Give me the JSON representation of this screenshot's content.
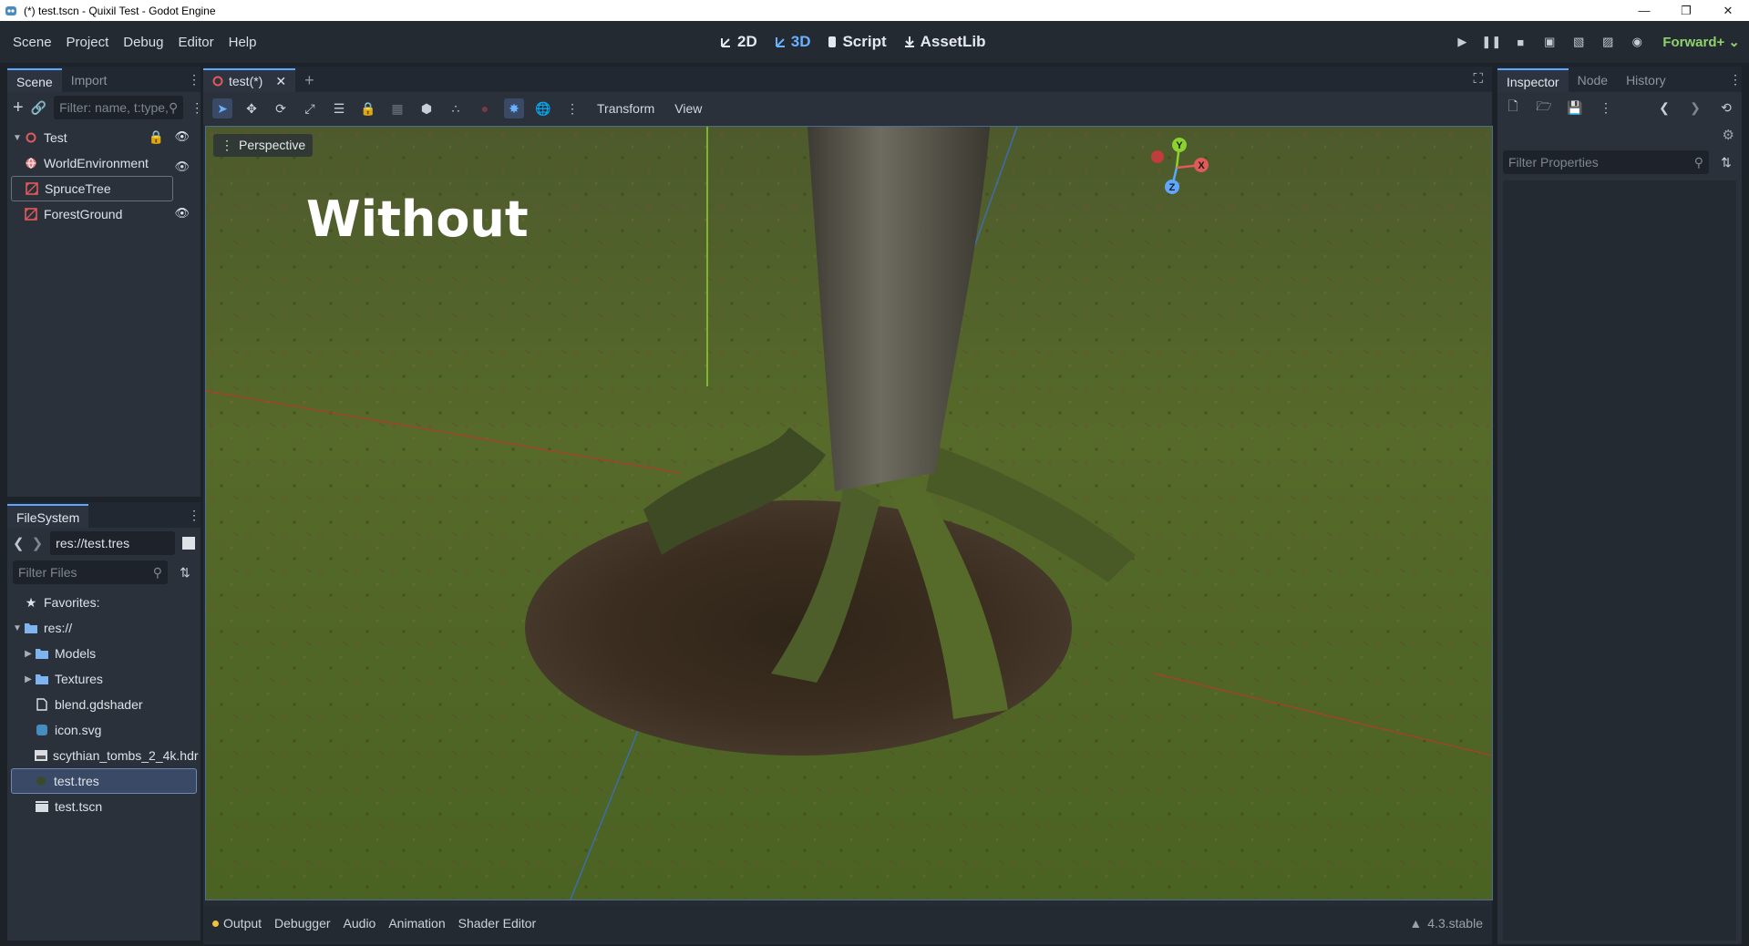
{
  "window": {
    "title": "(*) test.tscn - Quixil Test - Godot Engine",
    "minimize_icon": "minimize-icon",
    "maximize_icon": "restore-icon",
    "close_icon": "close-icon"
  },
  "menu": [
    "Scene",
    "Project",
    "Debug",
    "Editor",
    "Help"
  ],
  "workspaces": [
    {
      "label": "2D",
      "icon": "2d-icon",
      "active": false
    },
    {
      "label": "3D",
      "icon": "3d-icon",
      "active": true
    },
    {
      "label": "Script",
      "icon": "script-icon",
      "active": false
    },
    {
      "label": "AssetLib",
      "icon": "assetlib-icon",
      "active": false
    }
  ],
  "renderer": "Forward+",
  "scene_dock": {
    "tabs": [
      "Scene",
      "Import"
    ],
    "filter_placeholder": "Filter: name, t:type,",
    "nodes": [
      {
        "name": "Test",
        "icon": "node3d-icon"
      },
      {
        "name": "WorldEnvironment",
        "icon": "world-environment-icon"
      },
      {
        "name": "SpruceTree",
        "icon": "mesh-instance-icon"
      },
      {
        "name": "ForestGround",
        "icon": "mesh-instance-icon"
      }
    ]
  },
  "filesystem": {
    "tab": "FileSystem",
    "path": "res://test.tres",
    "filter_placeholder": "Filter Files",
    "items": [
      {
        "label": "Favorites:",
        "icon": "star-icon"
      },
      {
        "label": "res://",
        "icon": "folder-icon"
      },
      {
        "label": "Models",
        "icon": "folder-icon"
      },
      {
        "label": "Textures",
        "icon": "folder-icon"
      },
      {
        "label": "blend.gdshader",
        "icon": "shader-file-icon"
      },
      {
        "label": "icon.svg",
        "icon": "image-icon"
      },
      {
        "label": "scythian_tombs_2_4k.hdr",
        "icon": "hdr-image-icon"
      },
      {
        "label": "test.tres",
        "icon": "resource-icon"
      },
      {
        "label": "test.tscn",
        "icon": "scene-icon"
      }
    ]
  },
  "scene_tab": {
    "label": "test(*)"
  },
  "viewport_toolbar": {
    "transform": "Transform",
    "view": "View"
  },
  "viewport": {
    "perspective": "Perspective",
    "overlay_text": "Without"
  },
  "gizmo": {
    "x": "X",
    "y": "Y",
    "z": "Z"
  },
  "bottom_panel": {
    "tabs": [
      "Output",
      "Debugger",
      "Audio",
      "Animation",
      "Shader Editor"
    ],
    "version": "4.3.stable"
  },
  "inspector": {
    "tabs": [
      "Inspector",
      "Node",
      "History"
    ],
    "filter_placeholder": "Filter Properties"
  },
  "colors": {
    "accent": "#5ea7ff",
    "renderer": "#8fd36c",
    "node_red": "#e05a5a"
  }
}
